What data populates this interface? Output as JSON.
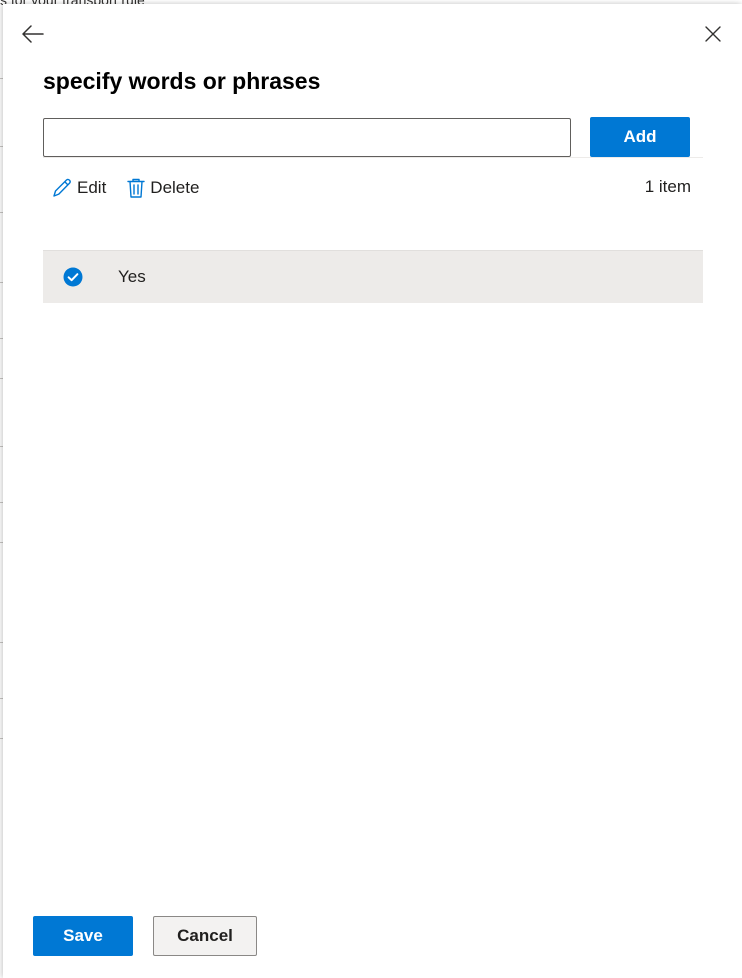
{
  "background": {
    "heading_fragment": "s for your transport rule"
  },
  "panel": {
    "title": "specify words or phrases",
    "input": {
      "value": "",
      "placeholder": ""
    },
    "add_label": "Add",
    "toolbar": {
      "edit_label": "Edit",
      "delete_label": "Delete"
    },
    "item_count": "1 item",
    "items": [
      {
        "text": "Yes",
        "selected": true
      }
    ],
    "footer": {
      "save_label": "Save",
      "cancel_label": "Cancel"
    }
  },
  "icons": {
    "back": "arrow-left-icon",
    "close": "close-icon",
    "edit": "pencil-icon",
    "delete": "trash-icon",
    "check": "checkmark-circle-icon"
  },
  "colors": {
    "accent": "#0078d4",
    "row_selected": "#edebe9",
    "text": "#201f1e"
  }
}
